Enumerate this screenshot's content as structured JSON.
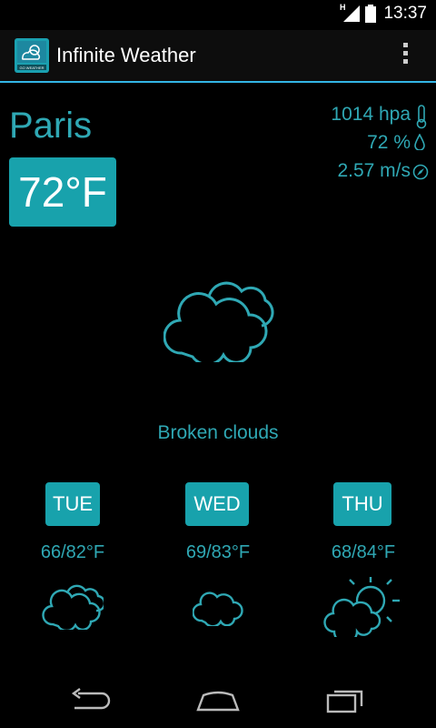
{
  "status_bar": {
    "time": "13:37",
    "network_label": "H"
  },
  "action_bar": {
    "title": "Infinite Weather",
    "app_icon_caption": "GO WEATHER"
  },
  "current": {
    "city": "Paris",
    "temperature": "72°F",
    "pressure": "1014 hpa",
    "humidity": "72 %",
    "wind": "2.57 m/s",
    "condition": "Broken clouds"
  },
  "forecast": [
    {
      "day": "TUE",
      "range": "66/82°F",
      "icon": "broken-clouds-icon"
    },
    {
      "day": "WED",
      "range": "69/83°F",
      "icon": "cloud-icon"
    },
    {
      "day": "THU",
      "range": "68/84°F",
      "icon": "sun-cloud-icon"
    }
  ],
  "colors": {
    "accent": "#2fa8b4",
    "box": "#18a2ac",
    "background": "#000000"
  }
}
